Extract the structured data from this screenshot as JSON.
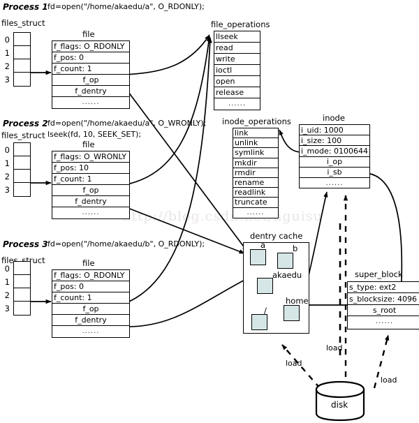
{
  "watermark": "http://blog.csdn.net/hguisu",
  "processes": [
    {
      "title": "Process 1",
      "code_lines": [
        "fd=open(\"/home/akaedu/a\", O_RDONLY);"
      ],
      "files_struct_label": "files_struct",
      "fd_indices": [
        "0",
        "1",
        "2",
        "3"
      ],
      "file_caption": "file",
      "file_rows": [
        "f_flags: O_RDONLY",
        "f_pos: 0",
        "f_count: 1",
        "f_op",
        "f_dentry",
        "......"
      ]
    },
    {
      "title": "Process 2",
      "code_lines": [
        "fd=open(\"/home/akaedu/a\", O_WRONLY);",
        "lseek(fd, 10, SEEK_SET);"
      ],
      "files_struct_label": "files_struct",
      "fd_indices": [
        "0",
        "1",
        "2",
        "3"
      ],
      "file_caption": "file",
      "file_rows": [
        "f_flags: O_WRONLY",
        "f_pos: 10",
        "f_count: 1",
        "f_op",
        "f_dentry",
        "......"
      ]
    },
    {
      "title": "Process 3",
      "code_lines": [
        "fd=open(\"/home/akaedu/b\", O_RDONLY);"
      ],
      "files_struct_label": "files_struct",
      "fd_indices": [
        "0",
        "1",
        "2",
        "3"
      ],
      "file_caption": "file",
      "file_rows": [
        "f_flags: O_RDONLY",
        "f_pos: 0",
        "f_count: 1",
        "f_op",
        "f_dentry",
        "......"
      ]
    }
  ],
  "file_operations": {
    "caption": "file_operations",
    "rows": [
      "llseek",
      "read",
      "write",
      "ioctl",
      "open",
      "release",
      "......"
    ]
  },
  "inode_operations": {
    "caption": "inode_operations",
    "rows": [
      "link",
      "unlink",
      "symlink",
      "mkdir",
      "rmdir",
      "rename",
      "readlink",
      "truncate",
      "......"
    ]
  },
  "inode": {
    "caption": "inode",
    "rows": [
      "i_uid: 1000",
      "i_size: 100",
      "i_mode: 0100644",
      "i_op",
      "i_sb",
      "......"
    ]
  },
  "super_block": {
    "caption": "super_block",
    "rows": [
      "s_type: ext2",
      "s_blocksize: 4096",
      "s_root",
      "......"
    ]
  },
  "dentry_cache": {
    "caption": "dentry cache",
    "nodes": [
      {
        "label": "a"
      },
      {
        "label": "b"
      },
      {
        "label": "akaedu"
      },
      {
        "label": "home"
      },
      {
        "label": "/"
      }
    ]
  },
  "disk": {
    "label": "disk",
    "load_labels": [
      "load",
      "load",
      "load"
    ]
  },
  "colors": {
    "stroke": "#000000",
    "dentry_node_fill": "#d6e6e6",
    "background": "#ffffff",
    "watermark": "#e9e4e4"
  }
}
